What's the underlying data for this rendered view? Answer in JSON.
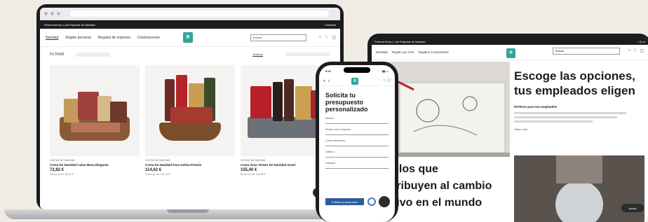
{
  "laptop": {
    "promo_left": "Primera firma | Lote Especial de Navidad",
    "promo_right": "Contacto",
    "nav": [
      {
        "label": "Navidad"
      },
      {
        "label": "Regalo personal"
      },
      {
        "label": "Regalos de empresa"
      },
      {
        "label": "Celebraciones"
      }
    ],
    "logo": "R",
    "search_placeholder": "Buscar",
    "filter_label": "FILTRAR",
    "sort_label": "Ordenar",
    "products": [
      {
        "brand": "CESTAS DE NAVIDAD",
        "name": "Cesta De Navidad Caixa Mesa Elegante",
        "price": "72,82 €",
        "old": "Precio de ref. 88,97 €"
      },
      {
        "brand": "CESTAS DE NAVIDAD",
        "name": "Cesta De Navidad Para Gelisa Premio",
        "price": "114,62 €",
        "old": "Precio de ref. 151,29 €"
      },
      {
        "brand": "CESTAS DE NAVIDAD",
        "name": "Cesta Gran Tentes De Navidad Good",
        "price": "155,40 €",
        "old": "Precio de ref. 194,83 €"
      }
    ]
  },
  "phone": {
    "time": "9:41",
    "title": "Solicita tu presupuesto personalizado",
    "fields": [
      "Nombre",
      "Nombre de tu empresa",
      "Correo electrónico",
      "Teléfono",
      "Cantidad"
    ],
    "submit_label": "Solicitar presupuesto"
  },
  "tablet": {
    "promo_left": "Primera firma | Lote Especial de Navidad",
    "nav": [
      {
        "label": "Navidad"
      },
      {
        "label": "Regalo por Vivir"
      },
      {
        "label": "Regalos Corporativos"
      }
    ],
    "search_placeholder": "Buscar",
    "heading": "Escoge las opciones, tus empleados eligen",
    "subheading": "Perfecto para tus empleados",
    "link_label": "Saber más",
    "overlay_text": "elos que\ntribuyen al cambio\ntivo en el mundo",
    "chat_label": "Ayuda"
  },
  "colors": {
    "background": "#f1ebe6",
    "brand_teal": "#2fa59a",
    "device_frame": "#1c1c1e"
  }
}
